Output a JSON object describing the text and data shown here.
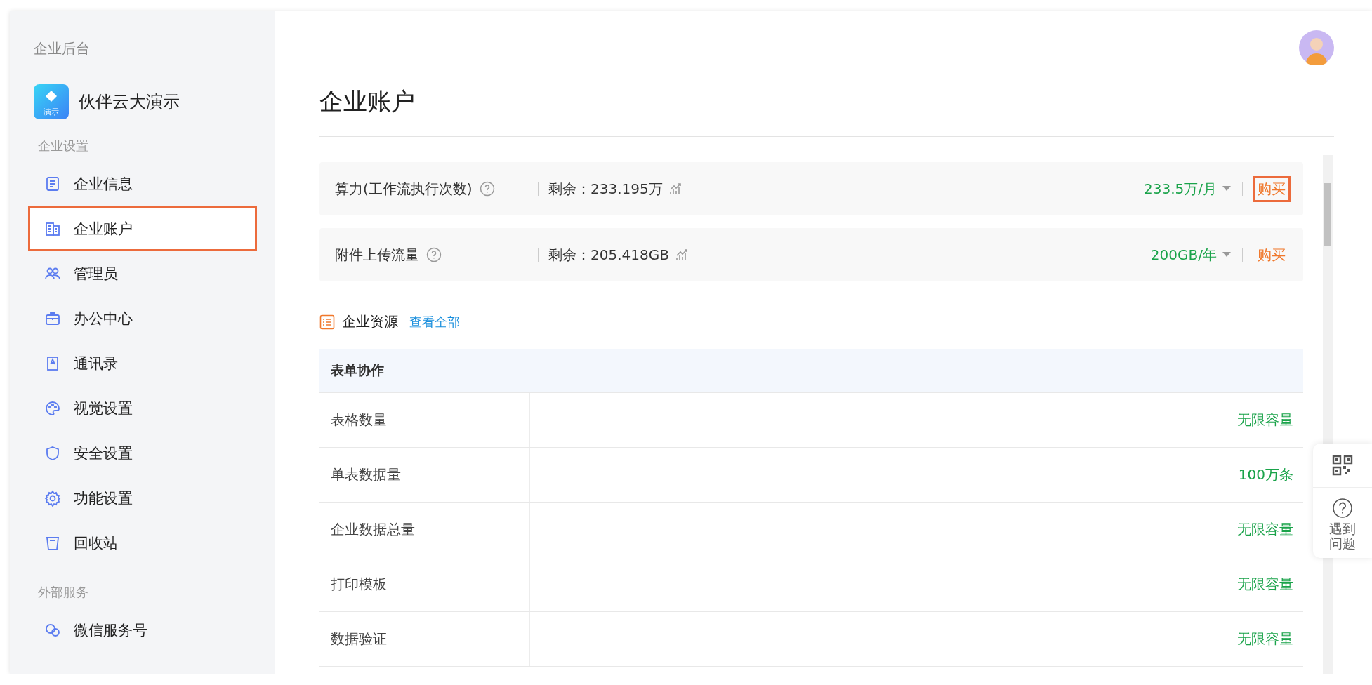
{
  "sidebar": {
    "title": "企业后台",
    "app": {
      "name": "伙伴云大演示",
      "logo_text": "演示"
    },
    "sections": [
      {
        "heading": "企业设置",
        "items": [
          {
            "label": "企业信息",
            "selected": false
          },
          {
            "label": "企业账户",
            "selected": true
          },
          {
            "label": "管理员",
            "selected": false
          },
          {
            "label": "办公中心",
            "selected": false
          },
          {
            "label": "通讯录",
            "selected": false
          },
          {
            "label": "视觉设置",
            "selected": false
          },
          {
            "label": "安全设置",
            "selected": false
          },
          {
            "label": "功能设置",
            "selected": false
          },
          {
            "label": "回收站",
            "selected": false
          }
        ]
      },
      {
        "heading": "外部服务",
        "items": [
          {
            "label": "微信服务号",
            "selected": false
          }
        ]
      }
    ]
  },
  "page": {
    "title": "企业账户"
  },
  "quotas": [
    {
      "name": "算力(工作流执行次数)",
      "remaining": "剩余：233.195万",
      "plan": "233.5万/月",
      "action": "购买",
      "highlighted": true
    },
    {
      "name": "附件上传流量",
      "remaining": "剩余：205.418GB",
      "plan": "200GB/年",
      "action": "购买",
      "highlighted": false
    }
  ],
  "resources": {
    "title": "企业资源",
    "link": "查看全部",
    "group": "表单协作",
    "rows": [
      {
        "name": "表格数量",
        "value": "无限容量"
      },
      {
        "name": "单表数据量",
        "value": "100万条"
      },
      {
        "name": "企业数据总量",
        "value": "无限容量"
      },
      {
        "name": "打印模板",
        "value": "无限容量"
      },
      {
        "name": "数据验证",
        "value": "无限容量"
      }
    ]
  },
  "help_widget": {
    "label": "遇到问题"
  }
}
